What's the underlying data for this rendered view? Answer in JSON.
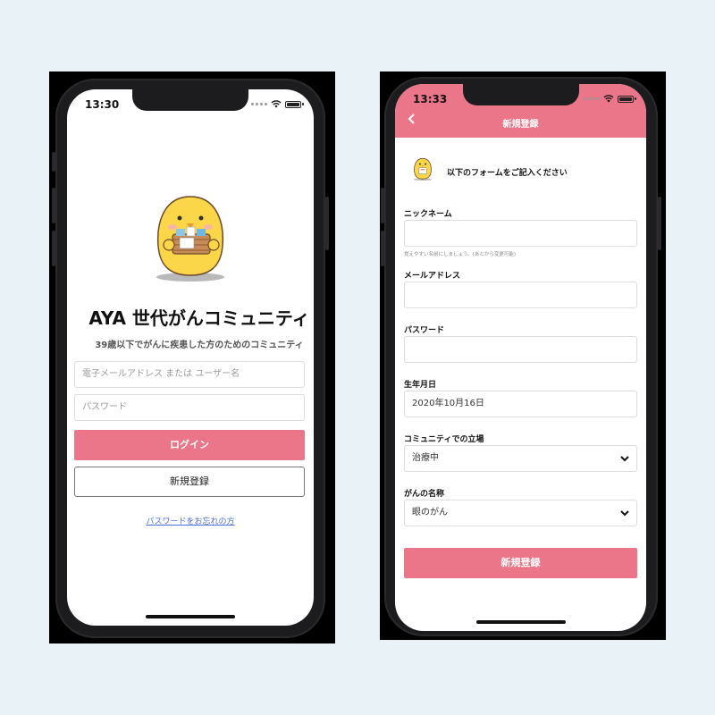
{
  "login_screen": {
    "status_time": "13:30",
    "app_title": "AYA 世代がんコミュニティ",
    "app_subtitle": "39歳以下でがんに疾患した方のためのコミュニティ",
    "username_placeholder": "電子メールアドレス または ユーザー名",
    "password_placeholder": "パスワード",
    "login_button": "ログイン",
    "register_button": "新規登録",
    "forgot_password_link": "パスワードをお忘れの方"
  },
  "register_screen": {
    "status_time": "13:33",
    "header_title": "新規登録",
    "intro_text": "以下のフォームをご記入ください",
    "fields": [
      {
        "label": "ニックネーム",
        "value": "",
        "hint": "覚えやすい名前にしましょう。(あとから変更可能)"
      },
      {
        "label": "メールアドレス",
        "value": ""
      },
      {
        "label": "パスワード",
        "value": ""
      },
      {
        "label": "生年月日",
        "value": "2020年10月16日"
      },
      {
        "label": "コミュニティでの立場",
        "value": "治療中"
      },
      {
        "label": "がんの名称",
        "value": "眼のがん"
      }
    ],
    "submit_button": "新規登録"
  },
  "colors": {
    "accent": "#ec7689",
    "background": "#e9f2f6",
    "link": "#4a6fd8"
  },
  "icons": [
    "chick-mascot",
    "wifi-icon",
    "battery-icon",
    "back-chevron-icon",
    "chevron-down-icon"
  ]
}
